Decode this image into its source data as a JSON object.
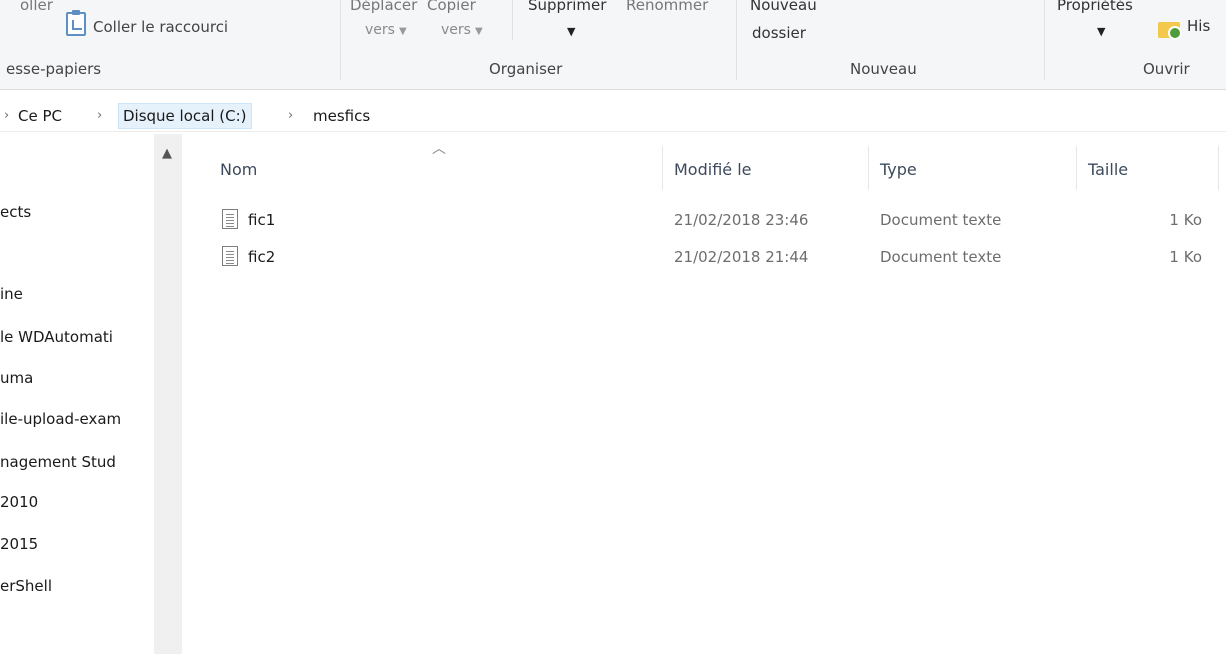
{
  "ribbon": {
    "clipboard": {
      "coller_partial": "oller",
      "coller_raccourci": "Coller le raccourci",
      "group_label": "esse-papiers"
    },
    "organiser": {
      "deplacer_top": "Déplacer",
      "deplacer_bottom": "vers",
      "copier_top": "Copier",
      "copier_bottom": "vers",
      "supprimer": "Supprimer",
      "renommer": "Renommer",
      "group_label": "Organiser"
    },
    "nouveau": {
      "nouveau_dossier_top": "Nouveau",
      "nouveau_dossier_bottom": "dossier",
      "group_label": "Nouveau"
    },
    "ouvrir": {
      "proprietes": "Propriétés",
      "historique_partial": "His",
      "group_label": "Ouvrir"
    }
  },
  "address": {
    "crumbs": [
      "Ce PC",
      "Disque local (C:)",
      "mesfics"
    ]
  },
  "nav": {
    "items": [
      "ects",
      "ine",
      "le WDAutomati",
      "uma",
      "ile-upload-exam",
      "nagement Stud",
      "2010",
      "2015",
      "erShell"
    ]
  },
  "files": {
    "columns": {
      "name": "Nom",
      "modified": "Modifié le",
      "type": "Type",
      "size": "Taille"
    },
    "rows": [
      {
        "name": "fic1",
        "modified": "21/02/2018 23:46",
        "type": "Document texte",
        "size": "1 Ko"
      },
      {
        "name": "fic2",
        "modified": "21/02/2018 21:44",
        "type": "Document texte",
        "size": "1 Ko"
      }
    ]
  }
}
